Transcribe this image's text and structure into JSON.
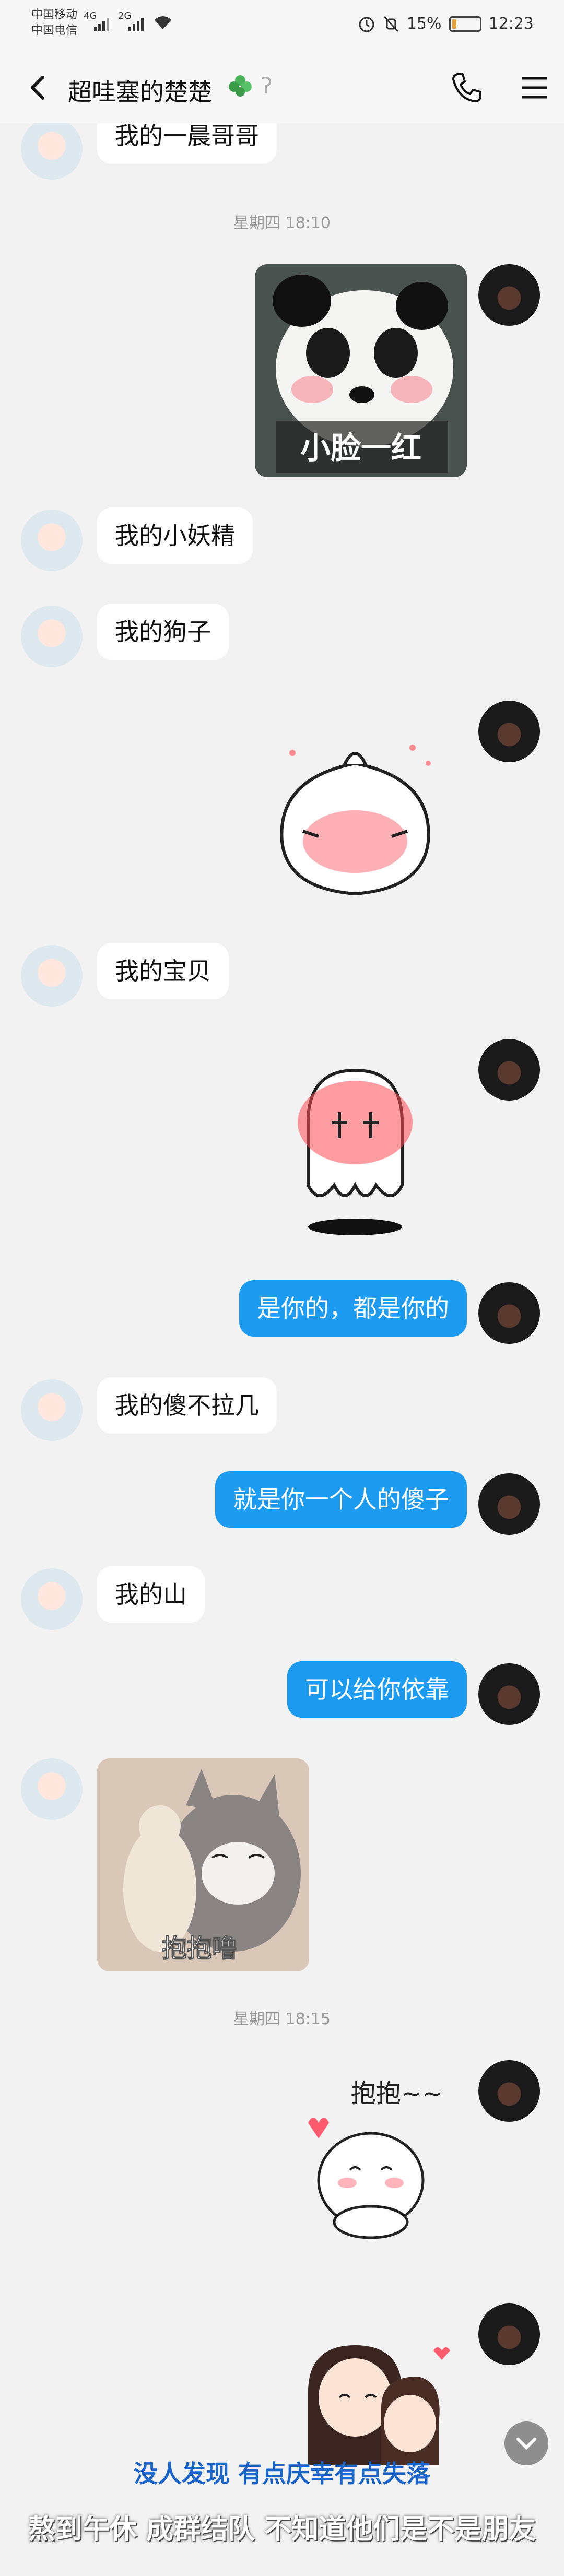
{
  "status": {
    "carrier1": "中国移动",
    "carrier2": "中国电信",
    "signal1": "4G",
    "signal2": "2G",
    "battery": "15%",
    "battery_level": 0.15,
    "time": "12:23"
  },
  "header": {
    "title": "超哇塞的楚楚",
    "back_icon": "back-arrow-icon",
    "phone_icon": "phone-icon",
    "menu_icon": "menu-icon"
  },
  "messages": [
    {
      "side": "in",
      "text": "我的一晨哥哥"
    },
    {
      "timestamp": "星期四 18:10"
    },
    {
      "side": "out",
      "sticker": "panda",
      "text": "小脸一红"
    },
    {
      "side": "in",
      "text": "我的小妖精"
    },
    {
      "side": "in",
      "text": "我的狗子"
    },
    {
      "side": "out",
      "sticker": "blush-bun"
    },
    {
      "side": "in",
      "text": "我的宝贝"
    },
    {
      "side": "out",
      "sticker": "shy-ghost"
    },
    {
      "side": "out",
      "text": "是你的，都是你的"
    },
    {
      "side": "in",
      "text": "我的傻不拉几"
    },
    {
      "side": "out",
      "text": "就是你一个人的傻子"
    },
    {
      "side": "in",
      "text": "我的山"
    },
    {
      "side": "out",
      "text": "可以给你依靠"
    },
    {
      "side": "in",
      "sticker": "kitten",
      "text": "抱抱噜"
    },
    {
      "timestamp": "星期四 18:15"
    },
    {
      "side": "out",
      "sticker": "hug-bun",
      "text": "抱抱~~"
    },
    {
      "side": "out",
      "sticker": "couple"
    }
  ],
  "captions": {
    "line1": "没人发现 有点庆幸有点失落",
    "line2": "熬到午休 成群结队 不知道他们是不是朋友"
  },
  "colors": {
    "out_bubble": "#1d9bf0",
    "in_bubble": "#ffffff",
    "background": "#f2f2f2",
    "caption_blue": "#1a64c9"
  }
}
